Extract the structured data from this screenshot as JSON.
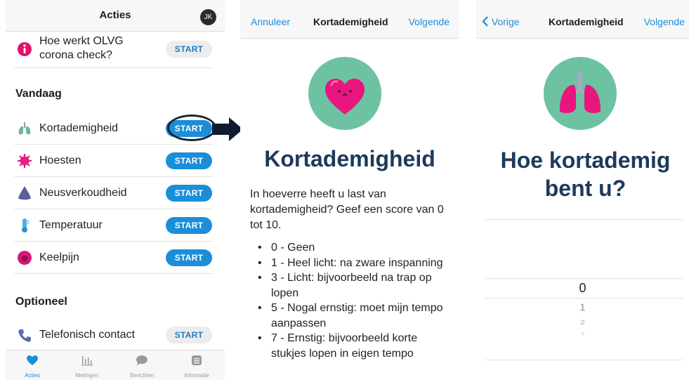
{
  "panel1": {
    "header_title": "Acties",
    "avatar_initials": "JK",
    "info_item": {
      "label_line1": "Hoe werkt OLVG",
      "label_line2": "corona check?",
      "button": "START"
    },
    "section_today": "Vandaag",
    "today_items": [
      {
        "label": "Kortademigheid",
        "button": "START",
        "icon": "lungs-icon"
      },
      {
        "label": "Hoesten",
        "button": "START",
        "icon": "virus-icon"
      },
      {
        "label": "Neusverkoudheid",
        "button": "START",
        "icon": "nose-icon"
      },
      {
        "label": "Temperatuur",
        "button": "START",
        "icon": "thermometer-icon"
      },
      {
        "label": "Keelpijn",
        "button": "START",
        "icon": "throat-icon"
      }
    ],
    "section_optional": "Optioneel",
    "optional_items": [
      {
        "label": "Telefonisch contact",
        "button": "START",
        "icon": "phone-icon"
      }
    ],
    "tabs": [
      {
        "label": "Acties",
        "icon": "heart-icon",
        "active": true
      },
      {
        "label": "Metingen",
        "icon": "bar-chart-icon",
        "active": false
      },
      {
        "label": "Berichten",
        "icon": "chat-bubble-icon",
        "active": false
      },
      {
        "label": "Informatie",
        "icon": "document-icon",
        "active": false
      }
    ],
    "colors": {
      "accent": "#1c8ed8"
    }
  },
  "panel2": {
    "nav_left": "Annuleer",
    "nav_title": "Kortademigheid",
    "nav_right": "Volgende",
    "hero_icon": "heart-face-icon",
    "title": "Kortademigheid",
    "intro": "In hoeverre heeft u last van kortademigheid? Geef een score van 0 tot 10.",
    "bullets": [
      "0 - Geen",
      "1 - Heel licht: na zware inspanning",
      "3 - Licht: bijvoorbeeld na trap op lopen",
      "5 - Nogal ernstig: moet mijn tempo aanpassen",
      "7 - Ernstig: bijvoorbeeld korte stukjes lopen in eigen tempo"
    ]
  },
  "panel3": {
    "nav_back": "Vorige",
    "nav_title": "Kortademigheid",
    "nav_right": "Volgende",
    "hero_icon": "lungs-icon",
    "title_line1": "Hoe kortademig",
    "title_line2": "bent u?",
    "picker_values": [
      "0",
      "1",
      "2",
      "3"
    ],
    "selected_value": "0"
  }
}
